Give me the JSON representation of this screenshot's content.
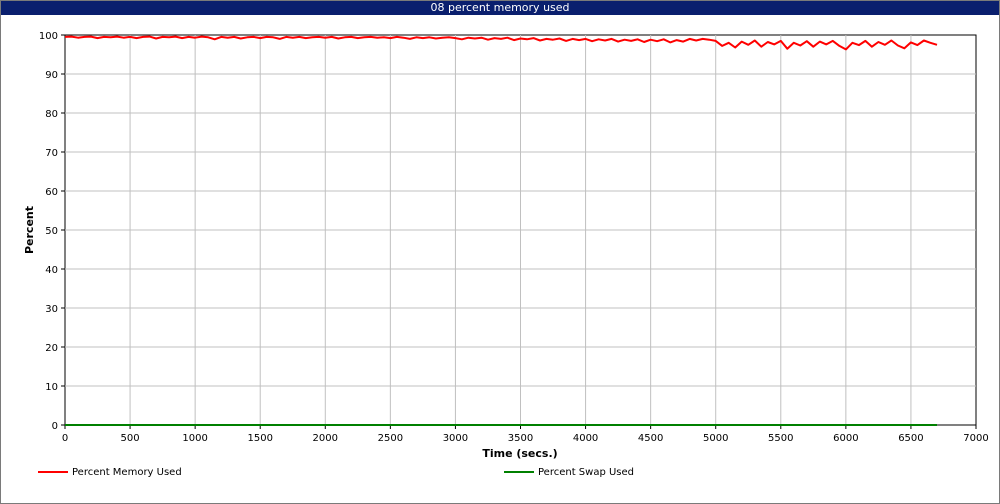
{
  "window": {
    "title": "08 percent memory used"
  },
  "colors": {
    "titlebar": "#0a1f6e",
    "memory": "#ff0000",
    "swap": "#008000",
    "grid": "#c0c0c0"
  },
  "chart_data": {
    "type": "line",
    "title": "08 percent memory used",
    "xlabel": "Time (secs.)",
    "ylabel": "Percent",
    "xlim": [
      0,
      7000
    ],
    "ylim": [
      0,
      100
    ],
    "x_ticks": [
      "0",
      "500",
      "1000",
      "1500",
      "2000",
      "2500",
      "3000",
      "3500",
      "4000",
      "4500",
      "5000",
      "5500",
      "6000",
      "6500",
      "7000"
    ],
    "y_ticks": [
      "0",
      "10",
      "20",
      "30",
      "40",
      "50",
      "60",
      "70",
      "80",
      "90",
      "100"
    ],
    "grid": true,
    "legend_position": "bottom",
    "series": [
      {
        "name": "Percent Memory Used",
        "color": "#ff0000",
        "x": [
          0,
          50,
          100,
          150,
          200,
          250,
          300,
          350,
          400,
          450,
          500,
          550,
          600,
          650,
          700,
          750,
          800,
          850,
          900,
          950,
          1000,
          1050,
          1100,
          1150,
          1200,
          1250,
          1300,
          1350,
          1400,
          1450,
          1500,
          1550,
          1600,
          1650,
          1700,
          1750,
          1800,
          1850,
          1900,
          1950,
          2000,
          2050,
          2100,
          2150,
          2200,
          2250,
          2300,
          2350,
          2400,
          2450,
          2500,
          2550,
          2600,
          2650,
          2700,
          2750,
          2800,
          2850,
          2900,
          2950,
          3000,
          3050,
          3100,
          3150,
          3200,
          3250,
          3300,
          3350,
          3400,
          3450,
          3500,
          3550,
          3600,
          3650,
          3700,
          3750,
          3800,
          3850,
          3900,
          3950,
          4000,
          4050,
          4100,
          4150,
          4200,
          4250,
          4300,
          4350,
          4400,
          4450,
          4500,
          4550,
          4600,
          4650,
          4700,
          4750,
          4800,
          4850,
          4900,
          4950,
          5000,
          5050,
          5100,
          5150,
          5200,
          5250,
          5300,
          5350,
          5400,
          5450,
          5500,
          5550,
          5600,
          5650,
          5700,
          5750,
          5800,
          5850,
          5900,
          5950,
          6000,
          6050,
          6100,
          6150,
          6200,
          6250,
          6300,
          6350,
          6400,
          6450,
          6500,
          6550,
          6600,
          6650,
          6700
        ],
        "values": [
          99.5,
          99.6,
          99.3,
          99.5,
          99.6,
          99.2,
          99.5,
          99.4,
          99.6,
          99.3,
          99.5,
          99.2,
          99.5,
          99.6,
          99.1,
          99.5,
          99.4,
          99.6,
          99.2,
          99.5,
          99.3,
          99.6,
          99.4,
          98.9,
          99.5,
          99.3,
          99.5,
          99.1,
          99.4,
          99.5,
          99.2,
          99.5,
          99.4,
          99.0,
          99.5,
          99.3,
          99.5,
          99.2,
          99.4,
          99.5,
          99.3,
          99.5,
          99.1,
          99.4,
          99.5,
          99.2,
          99.4,
          99.5,
          99.3,
          99.4,
          99.2,
          99.5,
          99.3,
          99.0,
          99.4,
          99.2,
          99.4,
          99.1,
          99.3,
          99.4,
          99.2,
          98.9,
          99.3,
          99.1,
          99.3,
          98.8,
          99.2,
          99.0,
          99.3,
          98.7,
          99.1,
          98.9,
          99.2,
          98.6,
          99.0,
          98.8,
          99.1,
          98.5,
          99.0,
          98.7,
          99.0,
          98.4,
          98.9,
          98.6,
          99.0,
          98.3,
          98.8,
          98.5,
          98.9,
          98.2,
          98.8,
          98.4,
          98.9,
          98.1,
          98.7,
          98.3,
          99.0,
          98.6,
          99.0,
          98.8,
          98.5,
          97.2,
          98.0,
          96.8,
          98.3,
          97.5,
          98.6,
          97.0,
          98.2,
          97.6,
          98.5,
          96.5,
          98.0,
          97.3,
          98.4,
          97.0,
          98.3,
          97.6,
          98.5,
          97.2,
          96.3,
          98.0,
          97.4,
          98.5,
          97.0,
          98.2,
          97.5,
          98.6,
          97.3,
          96.6,
          98.1,
          97.4,
          98.6,
          98.0,
          97.5
        ]
      },
      {
        "name": "Percent Swap Used",
        "color": "#008000",
        "x": [
          0,
          6700
        ],
        "values": [
          0,
          0
        ]
      }
    ]
  }
}
